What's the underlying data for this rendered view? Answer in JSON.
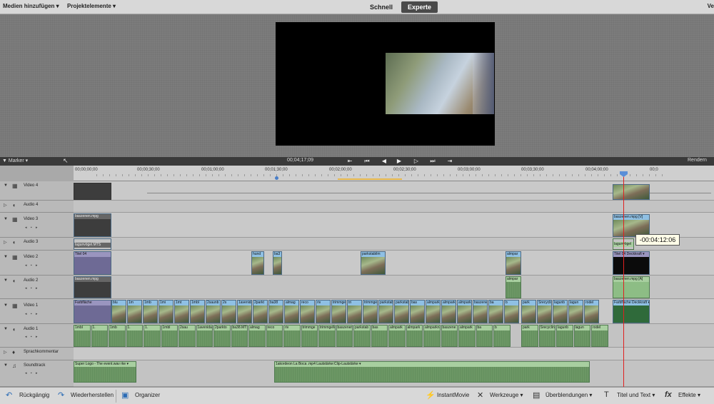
{
  "menu": {
    "add_media": "Medien hinzufügen",
    "project_assets": "Projektelemente"
  },
  "modes": {
    "quick": "Schnell",
    "expert": "Experte"
  },
  "topbar_edge": "Ve",
  "transport": {
    "marker_label": "Marker",
    "timecode": "00;04;17;09",
    "render_label": "Rendern",
    "buttons": [
      "go-to-start",
      "step-back-clip",
      "step-back-frame",
      "play",
      "step-forward-frame",
      "step-forward-clip",
      "go-to-end"
    ]
  },
  "ruler": {
    "labels": [
      "00;00;00;00",
      "00;00;30;00",
      "00;01;00;00",
      "00;01;30;00",
      "00;02;00;00",
      "00;02;30;00",
      "00;03;00;00",
      "00;03;30;00",
      "00;04;00;00",
      "00;0"
    ]
  },
  "tracks": [
    {
      "name": "Video 4",
      "type": "video"
    },
    {
      "name": "Audio 4",
      "type": "audio"
    },
    {
      "name": "Video 3",
      "type": "video"
    },
    {
      "name": "Audio 3",
      "type": "audio"
    },
    {
      "name": "Video 2",
      "type": "video"
    },
    {
      "name": "Audio 2",
      "type": "audio"
    },
    {
      "name": "Video 1",
      "type": "video"
    },
    {
      "name": "Audio 1",
      "type": "audio"
    },
    {
      "name": "Sprachkommentar",
      "type": "narration"
    },
    {
      "name": "Soundtrack",
      "type": "soundtrack"
    }
  ],
  "clips": {
    "v3_start": "baszenen.mpg",
    "a3_start": "lagunvögel.MTS",
    "v3_end": "baszenen.mpg [V]",
    "a3_end": "lagunvögel",
    "v2_start": "Titel 04",
    "v2_hund": "hund",
    "v2_ba3": "ba3",
    "v2_park": "parkstabilm",
    "v2_almpar": "almpar",
    "v2_end": "Titel 04",
    "v2_end_fx": "Deckkraft",
    "a2_start": "baszenen.mpg",
    "a2_almpar": "almpar",
    "a2_end": "baszenen.mpg [A]",
    "v1_start": "Farbfläche",
    "v1_end": "Farbfläche",
    "v1_end_fx": "Deckkraft",
    "v1_row": [
      "blu",
      "1m",
      "1mb",
      "1mi",
      "1mt",
      "1mbl",
      "2saunb",
      "2s",
      "1avenida2.MTS",
      "2parkt",
      "ba38",
      "almag",
      "reco",
      "riv",
      "trimmge",
      "tri",
      "trimmge",
      "parkstabil.mp4",
      "parkstab",
      "bas",
      "almpark2",
      "almpark",
      "almparknah",
      "baszene",
      "ba",
      "b",
      "park",
      "Srecyclin",
      "lagunb",
      "lagun",
      "rodel"
    ],
    "a1_row": [
      "1mbl",
      "1.",
      "1mb",
      "1.",
      "1.",
      "1mbl",
      "2sau",
      "1avenida",
      "2parkto",
      "ba38.MTS",
      "almag",
      "reco",
      "riv",
      "trimmge",
      "trimmgeM",
      "baszenen.mpg [A]",
      "parkstab",
      "bas",
      "almpark",
      "almpark",
      "almparknah",
      "baszene",
      "almpark",
      "ba",
      "b",
      "park",
      "Srecyclin",
      "lagunb",
      "lagun",
      "rodel"
    ],
    "soundtrack_1": "Super Logo - The event.wav",
    "soundtrack_1_fx": "rke",
    "soundtrack_2": "1akordeon La Boca .mp4",
    "soundtrack_2_fx": "Lautstärke:Clip-Lautstärke"
  },
  "playhead_tooltip": "-00:04:12:06",
  "bottom": {
    "undo": "Rückgängig",
    "redo": "Wiederherstellen",
    "organizer": "Organizer",
    "instant_movie": "InstantMovie",
    "tools": "Werkzeuge",
    "transitions": "Überblendungen",
    "titles": "Titel und Text",
    "effects": "Effekte"
  },
  "colors": {
    "accent": "#2a6bb5",
    "playhead": "#e02020",
    "video_clip": "#8fc0e4",
    "audio_clip": "#a8cfa0",
    "expert_mode_bg": "#4a4a4a"
  }
}
